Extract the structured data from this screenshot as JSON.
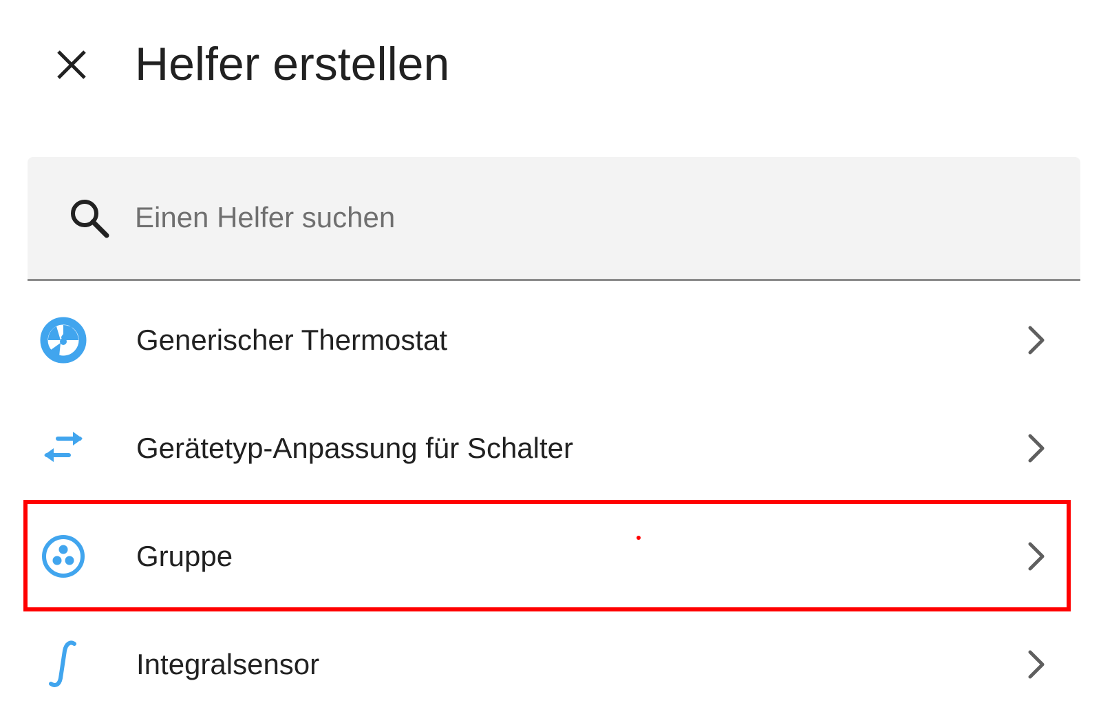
{
  "header": {
    "title": "Helfer erstellen",
    "close_icon": "close-icon"
  },
  "search": {
    "placeholder": "Einen Helfer suchen",
    "value": "",
    "icon": "search-icon"
  },
  "helpers": [
    {
      "label": "Generischer Thermostat",
      "icon": "thermostat-icon",
      "selected": false
    },
    {
      "label": "Gerätetyp-Anpassung für Schalter",
      "icon": "switch-as-x-icon",
      "selected": false
    },
    {
      "label": "Gruppe",
      "icon": "group-icon",
      "selected": true
    },
    {
      "label": "Integralsensor",
      "icon": "integral-icon",
      "selected": false
    }
  ],
  "colors": {
    "accent": "#41a5ee",
    "highlight": "#ff0000",
    "text": "#212121",
    "search_background": "#f3f3f3",
    "chevron": "#5f5f5f"
  }
}
